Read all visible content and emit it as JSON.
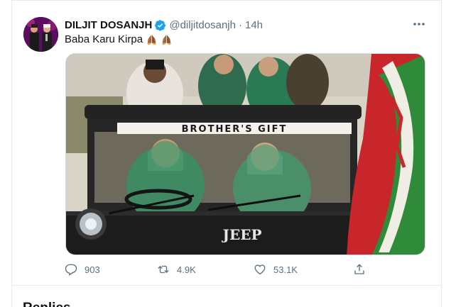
{
  "tweet": {
    "display_name": "DILJIT DOSANJH",
    "handle": "@diljitdosanjh",
    "separator": "·",
    "time": "14h",
    "text": "Baba Karu Kirpa",
    "text_emoji": "folded-hands-icon x2",
    "image_texts": {
      "vehicle_banner": "BROTHER'S GIFT",
      "hood_badge": "JEEP"
    },
    "actions": {
      "replies": "903",
      "retweets": "4.9K",
      "likes": "53.1K"
    }
  },
  "section": {
    "title": "Replies"
  },
  "colors": {
    "text_primary": "#0f1419",
    "text_secondary": "#5b7083",
    "verified_blue": "#1da1f2",
    "border": "#e6ecf0"
  }
}
